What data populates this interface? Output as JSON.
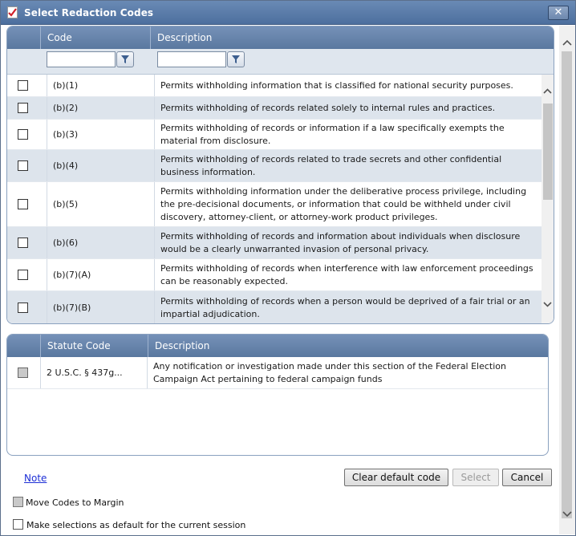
{
  "window": {
    "title": "Select Redaction Codes",
    "close_glyph": "✕"
  },
  "codes_grid": {
    "headers": {
      "code": "Code",
      "description": "Description"
    },
    "filters": {
      "code_value": "",
      "description_value": ""
    },
    "rows": [
      {
        "code": "(b)(1)",
        "description": "Permits withholding information that is classified for national security purposes.",
        "checked": false
      },
      {
        "code": "(b)(2)",
        "description": "Permits withholding of records related solely to internal rules and practices.",
        "checked": false
      },
      {
        "code": "(b)(3)",
        "description": "Permits withholding of records or information if a law specifically exempts the material from disclosure.",
        "checked": false
      },
      {
        "code": "(b)(4)",
        "description": "Permits withholding of records related to trade secrets and other confidential business information.",
        "checked": false
      },
      {
        "code": "(b)(5)",
        "description": "Permits withholding information under the deliberative process privilege, including the pre-decisional documents, or information that could be withheld under civil discovery, attorney-client, or attorney-work product privileges.",
        "checked": false
      },
      {
        "code": "(b)(6)",
        "description": "Permits withholding of records and information about individuals when disclosure would be a clearly unwarranted invasion of personal privacy.",
        "checked": false
      },
      {
        "code": "(b)(7)(A)",
        "description": "Permits withholding of records when interference with law enforcement proceedings can be reasonably expected.",
        "checked": false
      },
      {
        "code": "(b)(7)(B)",
        "description": "Permits withholding of records when a person would be deprived of a fair trial or an impartial adjudication.",
        "checked": false
      }
    ]
  },
  "statute_grid": {
    "headers": {
      "code": "Statute Code",
      "description": "Description"
    },
    "rows": [
      {
        "code": "2 U.S.C. § 437g...",
        "description": "Any notification or investigation made under this section of the Federal Election Campaign Act pertaining to federal campaign funds",
        "checked": false
      }
    ]
  },
  "footer": {
    "note_link": "Note",
    "clear_default_button": "Clear default code",
    "select_button": "Select",
    "cancel_button": "Cancel"
  },
  "options": {
    "move_codes_label": "Move Codes to Margin",
    "make_default_label": "Make selections as default for the current session"
  },
  "colors": {
    "titlebar": "#5a7aa8",
    "grid_header": "#6784ab",
    "alt_row": "#dde4ec",
    "link": "#1d2fd6"
  }
}
